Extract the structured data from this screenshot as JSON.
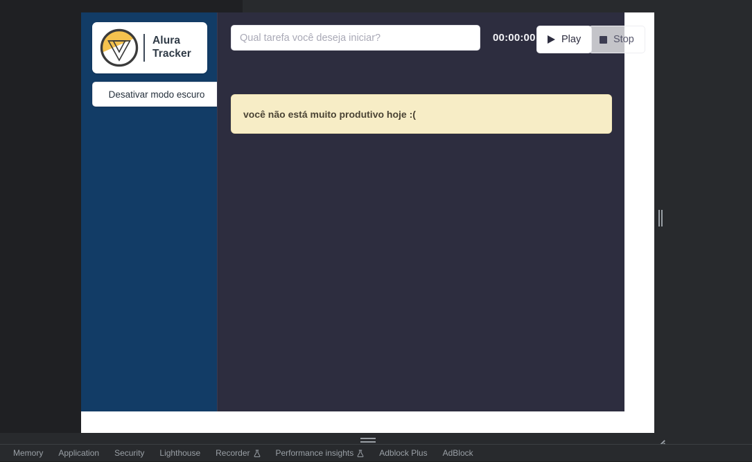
{
  "app": {
    "sidebar": {
      "logo": {
        "icon": "alura-v-logo-icon",
        "line1": "Alura",
        "line2": "Tracker"
      },
      "dark_mode_button": "Desativar modo escuro"
    },
    "header": {
      "task_input_placeholder": "Qual tarefa você deseja iniciar?",
      "task_input_value": "",
      "timer": "00:00:00",
      "play_button": "Play",
      "play_icon": "play-triangle-icon",
      "stop_button": "Stop",
      "stop_icon": "stop-square-icon"
    },
    "message": "você não está muito produtivo hoje :("
  },
  "devtools": {
    "tabs": [
      {
        "label": "Memory",
        "experimental": false
      },
      {
        "label": "Application",
        "experimental": false
      },
      {
        "label": "Security",
        "experimental": false
      },
      {
        "label": "Lighthouse",
        "experimental": false
      },
      {
        "label": "Recorder",
        "experimental": true
      },
      {
        "label": "Performance insights",
        "experimental": true
      },
      {
        "label": "Adblock Plus",
        "experimental": false
      },
      {
        "label": "AdBlock",
        "experimental": false
      }
    ]
  },
  "colors": {
    "sidebar_blue": "#123c66",
    "app_dark": "#2d2d3f",
    "banner_yellow": "#f7edc6",
    "logo_yellow": "#f5c24e",
    "devtools_bg": "#282a2d"
  }
}
